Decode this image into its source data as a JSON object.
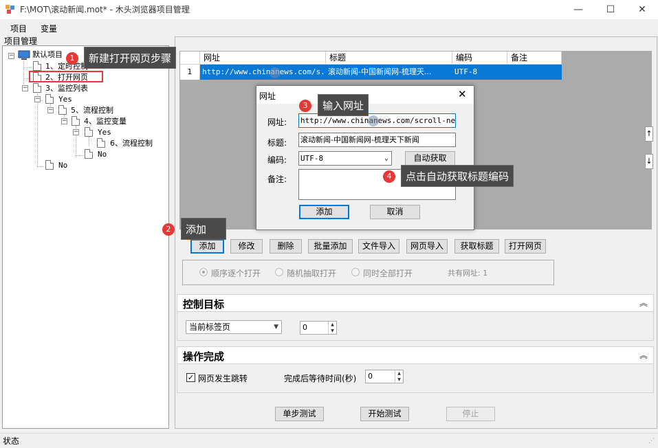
{
  "window": {
    "title": "F:\\MOT\\滚动新闻.mot* - 木头浏览器项目管理",
    "minimize_glyph": "—",
    "maximize_glyph": "☐",
    "close_glyph": "✕"
  },
  "menu": [
    "项目",
    "变量"
  ],
  "project_panel": {
    "label": "项目管理",
    "tree": [
      "默认项目",
      "1、定时控制",
      "2、打开网页",
      "3、监控列表",
      "Yes",
      "5、流程控制",
      "4、监控变量",
      "Yes",
      "6、流程控制",
      "No",
      "No"
    ]
  },
  "grid": {
    "columns": [
      "网址",
      "标题",
      "编码",
      "备注"
    ],
    "rows": [
      {
        "index": "1",
        "url": "http://www.chinanews.com/s...",
        "title": "滚动新闻-中国新闻网-梳理天...",
        "encoding": "UTF-8",
        "note": ""
      }
    ]
  },
  "toolbar": [
    "添加",
    "修改",
    "删除",
    "批量添加",
    "文件导入",
    "网页导入",
    "获取标题",
    "打开网页"
  ],
  "open_mode": {
    "options": [
      "顺序逐个打开",
      "随机抽取打开",
      "同时全部打开"
    ],
    "selected_index": 0,
    "total_label": "共有网址: 1"
  },
  "control_target": {
    "title": "控制目标",
    "tab_select": "当前标签页",
    "index_value": "0"
  },
  "operation_complete": {
    "title": "操作完成",
    "checkbox_label": "网页发生跳转",
    "checked": true,
    "wait_label": "完成后等待时间(秒)",
    "wait_value": "0"
  },
  "test_buttons": [
    "单步测试",
    "开始测试",
    "停止"
  ],
  "status": "状态",
  "dialog": {
    "title": "网址",
    "url_label": "网址:",
    "url_value": "http://www.chinanews.com/scroll-news/",
    "title_label": "标题:",
    "title_value": "滚动新闻-中国新闻网-梳理天下新闻",
    "encoding_label": "编码:",
    "encoding_value": "UTF-8",
    "auto_button": "自动获取",
    "note_label": "备注:",
    "note_value": "",
    "add_button": "添加",
    "cancel_button": "取消"
  },
  "callouts": [
    {
      "num": "1",
      "text": "新建打开网页步骤"
    },
    {
      "num": "2",
      "text": "添加"
    },
    {
      "num": "3",
      "text": "输入网址"
    },
    {
      "num": "4",
      "text": "点击自动获取标题编码"
    }
  ],
  "colors": {
    "accent": "#0078d7",
    "selection": "#0a78d7",
    "callout_badge": "#e53935",
    "callout_bg": "#4a4a4a"
  }
}
